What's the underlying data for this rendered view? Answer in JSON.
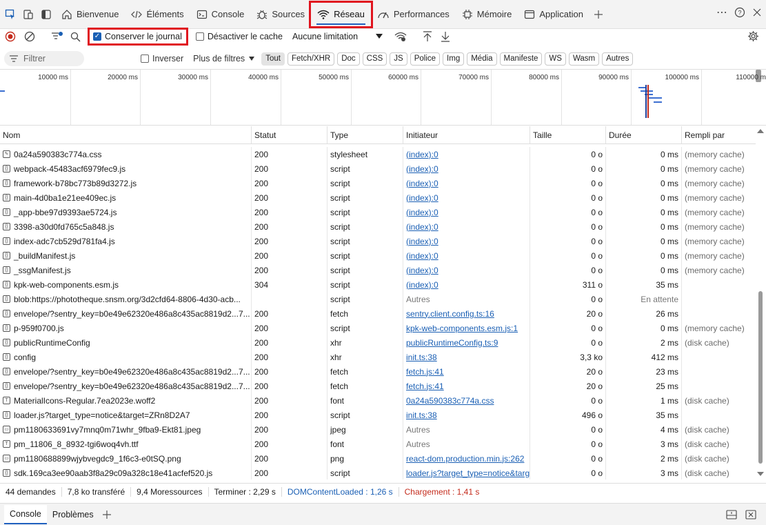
{
  "tabbar": {
    "tabs": [
      {
        "label": "Bienvenue",
        "icon": "home-icon"
      },
      {
        "label": "Éléments",
        "icon": "code-icon"
      },
      {
        "label": "Console",
        "icon": "console-icon"
      },
      {
        "label": "Sources",
        "icon": "bug-icon"
      },
      {
        "label": "Réseau",
        "icon": "wifi-icon"
      },
      {
        "label": "Performances",
        "icon": "performance-icon"
      },
      {
        "label": "Mémoire",
        "icon": "memory-icon"
      },
      {
        "label": "Application",
        "icon": "application-icon"
      }
    ],
    "active_tab": "Réseau"
  },
  "toolbar": {
    "preserve_log": "Conserver le journal",
    "disable_cache": "Désactiver le cache",
    "throttling": "Aucune limitation"
  },
  "filterbar": {
    "filter_placeholder": "Filtrer",
    "invert": "Inverser",
    "more_filters": "Plus de filtres",
    "chips": [
      "Tout",
      "Fetch/XHR",
      "Doc",
      "CSS",
      "JS",
      "Police",
      "Img",
      "Média",
      "Manifeste",
      "WS",
      "Wasm",
      "Autres"
    ],
    "active_chip": "Tout"
  },
  "overview": {
    "ticks": [
      "10000 ms",
      "20000 ms",
      "30000 ms",
      "40000 ms",
      "50000 ms",
      "60000 ms",
      "70000 ms",
      "80000 ms",
      "90000 ms",
      "100000 ms",
      "110000 ms"
    ]
  },
  "grid": {
    "headers": {
      "name": "Nom",
      "status": "Statut",
      "type": "Type",
      "initiator": "Initiateur",
      "size": "Taille",
      "duration": "Durée",
      "fulfilled": "Rempli par"
    },
    "rows": [
      {
        "name": "0a24a590383c774a.css",
        "status": "200",
        "type": "stylesheet",
        "initiator": "(index):0",
        "link": true,
        "size": "0 o",
        "duration": "0 ms",
        "fulfilled": "(memory cache)",
        "icon": "css"
      },
      {
        "name": "webpack-45483acf6979fec9.js",
        "status": "200",
        "type": "script",
        "initiator": "(index):0",
        "link": true,
        "size": "0 o",
        "duration": "0 ms",
        "fulfilled": "(memory cache)",
        "icon": "script"
      },
      {
        "name": "framework-b78bc773b89d3272.js",
        "status": "200",
        "type": "script",
        "initiator": "(index):0",
        "link": true,
        "size": "0 o",
        "duration": "0 ms",
        "fulfilled": "(memory cache)",
        "icon": "script"
      },
      {
        "name": "main-4d0ba1e21ee409ec.js",
        "status": "200",
        "type": "script",
        "initiator": "(index):0",
        "link": true,
        "size": "0 o",
        "duration": "0 ms",
        "fulfilled": "(memory cache)",
        "icon": "script"
      },
      {
        "name": "_app-bbe97d9393ae5724.js",
        "status": "200",
        "type": "script",
        "initiator": "(index):0",
        "link": true,
        "size": "0 o",
        "duration": "0 ms",
        "fulfilled": "(memory cache)",
        "icon": "script"
      },
      {
        "name": "3398-a30d0fd765c5a848.js",
        "status": "200",
        "type": "script",
        "initiator": "(index):0",
        "link": true,
        "size": "0 o",
        "duration": "0 ms",
        "fulfilled": "(memory cache)",
        "icon": "script"
      },
      {
        "name": "index-adc7cb529d781fa4.js",
        "status": "200",
        "type": "script",
        "initiator": "(index):0",
        "link": true,
        "size": "0 o",
        "duration": "0 ms",
        "fulfilled": "(memory cache)",
        "icon": "script"
      },
      {
        "name": "_buildManifest.js",
        "status": "200",
        "type": "script",
        "initiator": "(index):0",
        "link": true,
        "size": "0 o",
        "duration": "0 ms",
        "fulfilled": "(memory cache)",
        "icon": "script"
      },
      {
        "name": "_ssgManifest.js",
        "status": "200",
        "type": "script",
        "initiator": "(index):0",
        "link": true,
        "size": "0 o",
        "duration": "0 ms",
        "fulfilled": "(memory cache)",
        "icon": "script"
      },
      {
        "name": "kpk-web-components.esm.js",
        "status": "304",
        "type": "script",
        "initiator": "(index):0",
        "link": true,
        "size": "311 o",
        "duration": "35 ms",
        "fulfilled": "",
        "icon": "script"
      },
      {
        "name": "blob:https://phototheque.snsm.org/3d2cfd64-8806-4d30-acb...",
        "status": "",
        "type": "script",
        "initiator": "Autres",
        "link": false,
        "size": "0 o",
        "duration": "En attente",
        "fulfilled": "",
        "icon": "script"
      },
      {
        "name": "envelope/?sentry_key=b0e49e62320e486a8c435ac8819d2...7...",
        "status": "200",
        "type": "fetch",
        "initiator": "sentry.client.config.ts:16",
        "link": true,
        "size": "20 o",
        "duration": "26 ms",
        "fulfilled": "",
        "icon": "fetch"
      },
      {
        "name": "p-959f0700.js",
        "status": "200",
        "type": "script",
        "initiator": "kpk-web-components.esm.js:1",
        "link": true,
        "size": "0 o",
        "duration": "0 ms",
        "fulfilled": "(memory cache)",
        "icon": "script"
      },
      {
        "name": "publicRuntimeConfig",
        "status": "200",
        "type": "xhr",
        "initiator": "publicRuntimeConfig.ts:9",
        "link": true,
        "size": "0 o",
        "duration": "2 ms",
        "fulfilled": "(disk cache)",
        "icon": "fetch"
      },
      {
        "name": "config",
        "status": "200",
        "type": "xhr",
        "initiator": "init.ts:38",
        "link": true,
        "size": "3,3 ko",
        "duration": "412 ms",
        "fulfilled": "",
        "icon": "fetch"
      },
      {
        "name": "envelope/?sentry_key=b0e49e62320e486a8c435ac8819d2...7...",
        "status": "200",
        "type": "fetch",
        "initiator": "fetch.js:41",
        "link": true,
        "size": "20 o",
        "duration": "23 ms",
        "fulfilled": "",
        "icon": "fetch"
      },
      {
        "name": "envelope/?sentry_key=b0e49e62320e486a8c435ac8819d2...7...",
        "status": "200",
        "type": "fetch",
        "initiator": "fetch.js:41",
        "link": true,
        "size": "20 o",
        "duration": "25 ms",
        "fulfilled": "",
        "icon": "fetch"
      },
      {
        "name": "MaterialIcons-Regular.7ea2023e.woff2",
        "status": "200",
        "type": "font",
        "initiator": "0a24a590383c774a.css",
        "link": true,
        "size": "0 o",
        "duration": "1 ms",
        "fulfilled": "(disk cache)",
        "icon": "font"
      },
      {
        "name": "loader.js?target_type=notice&target=ZRn8D2A7",
        "status": "200",
        "type": "script",
        "initiator": "init.ts:38",
        "link": true,
        "size": "496 o",
        "duration": "35 ms",
        "fulfilled": "",
        "icon": "script"
      },
      {
        "name": "pm1180633691vy7mnq0m71whr_9fba9-Ekt81.jpeg",
        "status": "200",
        "type": "jpeg",
        "initiator": "Autres",
        "link": false,
        "size": "0 o",
        "duration": "4 ms",
        "fulfilled": "(disk cache)",
        "icon": "image"
      },
      {
        "name": "pm_11806_8_8932-tgi6woq4vh.ttf",
        "status": "200",
        "type": "font",
        "initiator": "Autres",
        "link": false,
        "size": "0 o",
        "duration": "3 ms",
        "fulfilled": "(disk cache)",
        "icon": "font"
      },
      {
        "name": "pm1180688899wjybvegdc9_1f6c3-e0tSQ.png",
        "status": "200",
        "type": "png",
        "initiator": "react-dom.production.min.js:262",
        "link": true,
        "size": "0 o",
        "duration": "2 ms",
        "fulfilled": "(disk cache)",
        "icon": "image"
      },
      {
        "name": "sdk.169ca3ee90aab3f8a29c09a328c18e41acfef520.js",
        "status": "200",
        "type": "script",
        "initiator": "loader.js?target_type=notice&targ",
        "link": true,
        "size": "0 o",
        "duration": "3 ms",
        "fulfilled": "(disk cache)",
        "icon": "script"
      }
    ]
  },
  "status": {
    "requests": "44 demandes",
    "transferred": "7,8 ko transféré",
    "resources": "9,4 Moressources",
    "finish": "Terminer : 2,29 s",
    "dcl": "DOMContentLoaded : 1,26 s",
    "load": "Chargement : 1,41 s"
  },
  "drawer": {
    "tabs": [
      "Console",
      "Problèmes"
    ]
  }
}
